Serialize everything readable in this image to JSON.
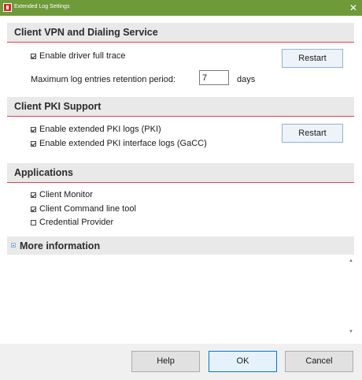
{
  "window": {
    "title": "Extended Log Settings",
    "close_label": "✕"
  },
  "vpn_section": {
    "title": "Client VPN and Dialing Service",
    "full_trace_label": "Enable driver full trace",
    "full_trace_checked": true,
    "restart_label": "Restart",
    "retention_label": "Maximum log entries retention period:",
    "retention_value": "7",
    "retention_unit": "days"
  },
  "pki_section": {
    "title": "Client PKI Support",
    "pki_logs_label": "Enable extended PKI logs (PKI)",
    "pki_logs_checked": true,
    "pki_interface_label": "Enable extended PKI interface logs (GaCC)",
    "pki_interface_checked": true,
    "restart_label": "Restart"
  },
  "applications": {
    "title": "Applications",
    "items": [
      {
        "label": "Client Monitor",
        "checked": true
      },
      {
        "label": "Client Command line tool",
        "checked": true
      },
      {
        "label": "Credential Provider",
        "checked": false
      }
    ]
  },
  "more_info": {
    "title": "More information",
    "expand_glyph": "+"
  },
  "footer": {
    "help_label": "Help",
    "ok_label": "OK",
    "cancel_label": "Cancel"
  },
  "colors": {
    "titlebar": "#6f9a3a",
    "section_underline": "#d8455a",
    "button_border": "#8fb4d8"
  }
}
